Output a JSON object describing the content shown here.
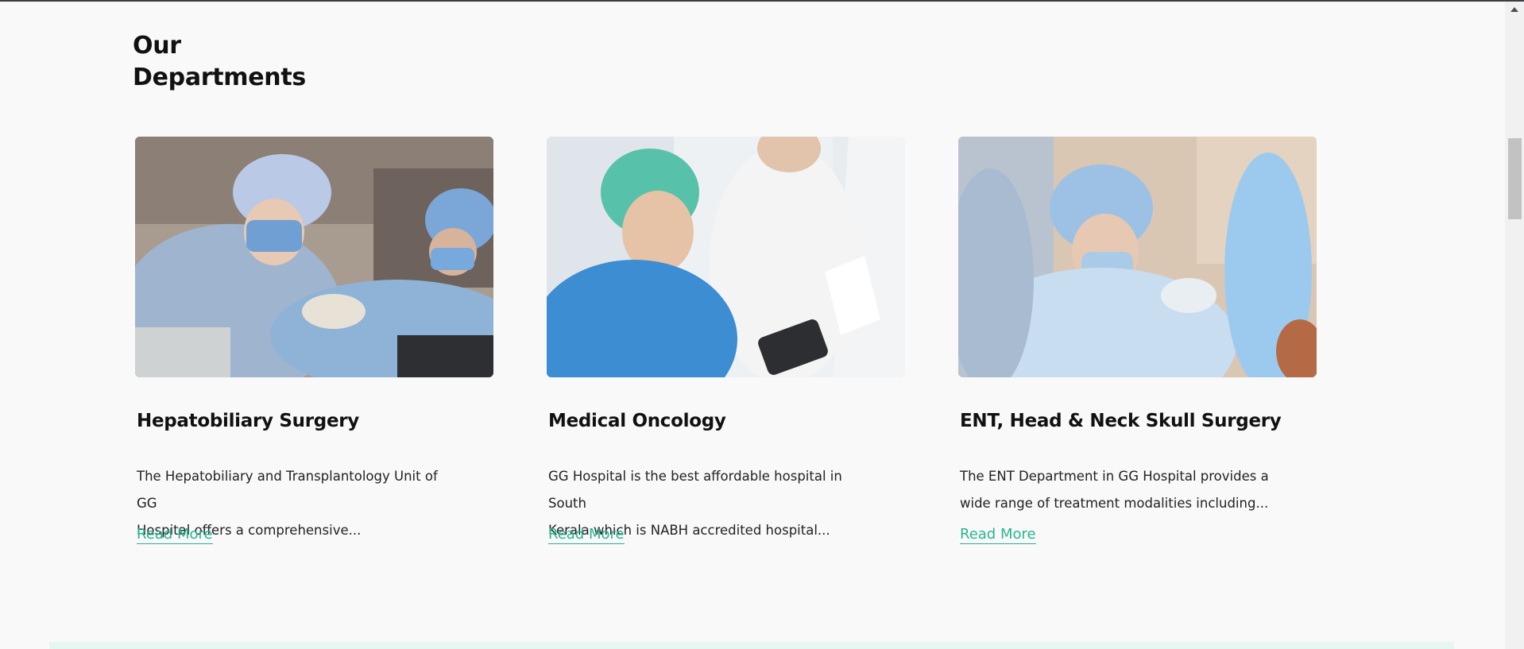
{
  "section": {
    "title_line1": "Our",
    "title_line2": "Departments"
  },
  "departments": [
    {
      "title": "Hepatobiliary Surgery",
      "description_line1": "The Hepatobiliary and Transplantology Unit of GG",
      "description_line2": "Hospital offers a comprehensive...",
      "link": "Read More",
      "image": "surgeons-operating-photo"
    },
    {
      "title": "Medical Oncology",
      "description_line1": "GG Hospital is the best affordable hospital in South",
      "description_line2": "Kerala which is NABH accredited hospital...",
      "link": "Read More",
      "image": "doctor-with-tablet-photo"
    },
    {
      "title": "ENT, Head & Neck Skull Surgery",
      "description_line1": "The ENT Department in GG Hospital provides a",
      "description_line2": "wide range of treatment modalities including...",
      "link": "Read More",
      "image": "surgeon-in-mask-photo"
    }
  ],
  "colors": {
    "accent": "#2bb393",
    "background": "#f9f9fa",
    "heading": "#111111"
  }
}
